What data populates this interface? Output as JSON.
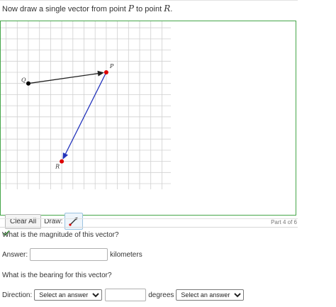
{
  "instruction": {
    "prefix": "Now draw a single vector from point ",
    "var_from": "P",
    "middle": " to point ",
    "var_to": "R",
    "suffix": "."
  },
  "graph": {
    "grid": true,
    "points": [
      {
        "label": "Q",
        "x": 0,
        "y": -1,
        "color": "#000000"
      },
      {
        "label": "P",
        "x": 7,
        "y": 0,
        "color": "#dd0000"
      },
      {
        "label": "R",
        "x": 3,
        "y": -8,
        "color": "#dd0000"
      }
    ],
    "vectors": [
      {
        "from": "Q",
        "to": "P",
        "color": "#222222"
      },
      {
        "from": "P",
        "to": "R",
        "color": "#2233bb"
      }
    ],
    "check_mark": "✓"
  },
  "toolbar": {
    "clear_label": "Clear All",
    "draw_label": "Draw:",
    "tool_icon": "vector-draw-icon"
  },
  "part": {
    "label": "Part 4 of 6"
  },
  "magnitude": {
    "question": "What is the magnitude of this vector?",
    "answer_label": "Answer:",
    "value": "",
    "unit": "kilometers"
  },
  "bearing": {
    "question": "What is the bearing for this vector?",
    "direction_label": "Direction:",
    "direction_selected": "Select an answer",
    "degrees_value": "",
    "degrees_label": "degrees",
    "second_selected": "Select an answer"
  },
  "colors": {
    "panel_border": "#45a649",
    "grid_line": "#d0d0d0",
    "vector_pr": "#2233bb",
    "vector_qp": "#222222",
    "point_red": "#dd0000",
    "check": "#3a9a3a"
  }
}
